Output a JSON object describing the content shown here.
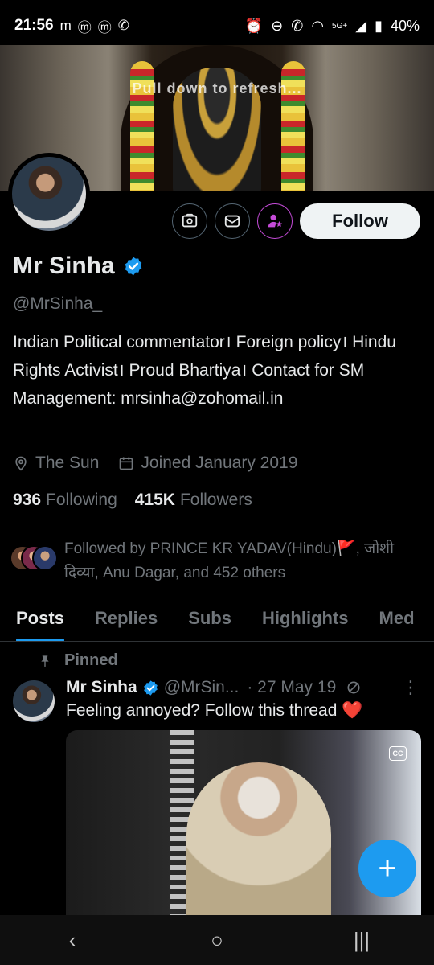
{
  "status_bar": {
    "time": "21:56",
    "notif_icons": [
      "m",
      "m",
      "m",
      "whatsapp-icon"
    ],
    "network": "5G+",
    "battery": "40%"
  },
  "banner": {
    "overlay_text": "Pull down to refresh..."
  },
  "profile": {
    "display_name": "Mr Sinha",
    "handle": "@MrSinha_",
    "bio": "Indian Political commentator। Foreign policy। Hindu Rights Activist। Proud Bhartiya। Contact for SM Management: mrsinha@zohomail.in",
    "location": "The Sun",
    "joined": "Joined January 2019",
    "following_count": "936",
    "following_label": "Following",
    "followers_count": "415K",
    "followers_label": "Followers",
    "followed_by": "Followed by PRINCE KR YADAV(Hindu)🚩, जोशी दिव्या, Anu Dagar, and 452 others",
    "follow_button": "Follow"
  },
  "tabs": [
    {
      "label": "Posts",
      "active": true
    },
    {
      "label": "Replies",
      "active": false
    },
    {
      "label": "Subs",
      "active": false
    },
    {
      "label": "Highlights",
      "active": false
    },
    {
      "label": "Med",
      "active": false
    }
  ],
  "pinned_post": {
    "pinned_label": "Pinned",
    "author": "Mr Sinha",
    "handle": "@MrSin...",
    "date": "· 27 May 19",
    "text": "Feeling annoyed? Follow this thread ❤️"
  },
  "colors": {
    "accent": "#1d9bf0",
    "background": "#000000",
    "secondary_text": "#71767b",
    "subscribe_purple": "#c54bd8"
  }
}
